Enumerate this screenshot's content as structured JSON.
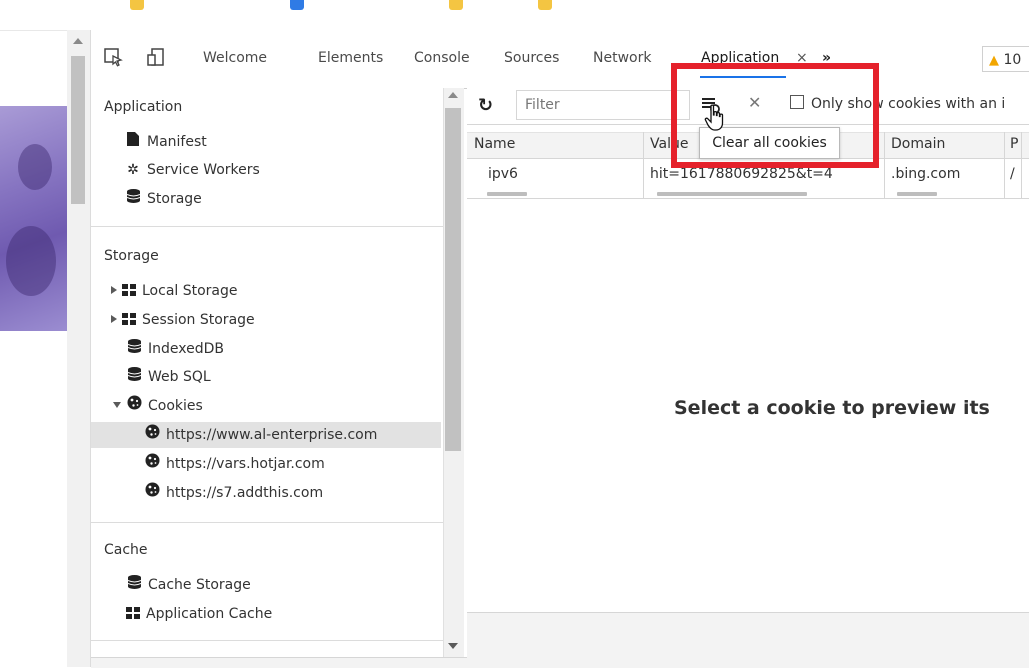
{
  "devtools_tabs": {
    "welcome": "Welcome",
    "elements": "Elements",
    "console": "Console",
    "sources": "Sources",
    "network": "Network",
    "application": "Application",
    "close_glyph": "×",
    "more_glyph": "»",
    "warning_count": "10"
  },
  "sidebar": {
    "application_header": "Application",
    "manifest": "Manifest",
    "service_workers": "Service Workers",
    "storage_item": "Storage",
    "storage_header": "Storage",
    "local_storage": "Local Storage",
    "session_storage": "Session Storage",
    "indexeddb": "IndexedDB",
    "web_sql": "Web SQL",
    "cookies": "Cookies",
    "cookie_origins": [
      "https://www.al-enterprise.com",
      "https://vars.hotjar.com",
      "https://s7.addthis.com"
    ],
    "cache_header": "Cache",
    "cache_storage": "Cache Storage",
    "application_cache": "Application Cache"
  },
  "toolbar": {
    "filter_placeholder": "Filter",
    "only_show_label": "Only show cookies with an i",
    "tooltip": "Clear all cookies"
  },
  "table": {
    "columns": [
      "Name",
      "Value",
      "Domain",
      "P"
    ],
    "row": {
      "name": "ipv6",
      "value": "hit=1617880692825&t=4",
      "domain": ".bing.com",
      "path": "/"
    }
  },
  "preview": {
    "message": "Select a cookie to preview its"
  },
  "colors": {
    "highlight": "#e5212b",
    "active_tab_underline": "#1a73e8",
    "warning": "#f2a600"
  }
}
